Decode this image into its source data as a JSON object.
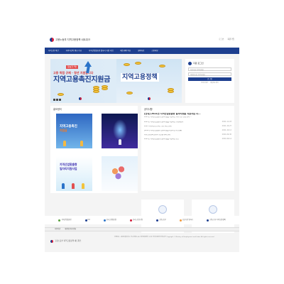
{
  "header": {
    "site_name": "고용노동부 지역고용정책 네트워크",
    "util_links": [
      "로그인",
      "회원가입"
    ]
  },
  "nav": {
    "items": [
      "지역고용 여건",
      "지역혁신이 뭐죠 주요",
      "지역산업맞춤형 일자리 지원 사업",
      "베트레의 목표",
      "회의자료",
      "소통마당"
    ]
  },
  "hero": {
    "left_badge": "정보가 딱!",
    "left_tag": "고용 독점 규제 · 청년 지원합니다",
    "left_title": "지역고용촉진지원금",
    "right_title": "지역고용정책"
  },
  "login": {
    "title": "지원 로그인",
    "id_placeholder": "아이디를 입력하세요",
    "pw_placeholder": "비밀번호를 입력하세요",
    "button": "로그인",
    "links": [
      "아이디 찾기",
      "비밀번호 찾기"
    ]
  },
  "promo": {
    "title": "홍보센터",
    "tiles": [
      {
        "line1": "지역고용촉진",
        "line2": "지원금"
      },
      {
        "line1": "",
        "line2": ""
      },
      {
        "line1": "지역산업맞춤형",
        "line2": "일자리지원사업"
      },
      {
        "line1": "",
        "line2": ""
      }
    ]
  },
  "notice": {
    "title": "공지사항",
    "feature_title": "[안내] 2021년 지역산업맞춤형 일자리창출 지원사업 지...",
    "feature_sub": "2021년 지역산업맞춤형 일자리창출 지원사업 지역 공모 선정 결과 ...",
    "rows": [
      {
        "title": "2021년 지역산업맞춤형 일자리창출 지원사업 수정계획서",
        "date": "2021-11-03"
      },
      {
        "title": "2021 지역혁신프로젝트 공모 사업 안내",
        "date": "2021-10-27"
      },
      {
        "title": "[2021] 지역산업맞춤형 일자리창출 지원사업 추진현황",
        "date": "2021-10-12"
      },
      {
        "title": "지역고용정책 담당자 워크숍 개최 안내",
        "date": "2021-09-30"
      },
      {
        "title": "2021년 지역산업맞춤형 일자리창출 지원사업 공고",
        "date": "2021-09-14"
      }
    ]
  },
  "cards": [
    {
      "title": "공지사항",
      "desc": "지역고용정책과 관련된 소식을 확인하세요"
    },
    {
      "title": "지역 맞춤형 사업",
      "desc": "지역 특성에 맞는 사업을 안내합니다"
    }
  ],
  "partners": [
    "지역산업맞춤형",
    "KLI",
    "한국고용정보원",
    "한국노동연구원",
    "고용노동부",
    "공공기관 일자리",
    "고용노동부 지역고용정책"
  ],
  "footer": {
    "links": [
      "이용약관",
      "개인정보처리방침"
    ],
    "logo": "고용노동부 지역고용정책 네트워크",
    "info": "우편번호 : 세종특별자치시 한누리대로 422 정부세종청사 11동 지역고용정책 네트워크 Copyright © Ministry of Employment and Labor. All rights reserved."
  },
  "colors": {
    "primary": "#1d3f8f",
    "accent": "#f2c33b",
    "background": "#f4f4f4"
  }
}
